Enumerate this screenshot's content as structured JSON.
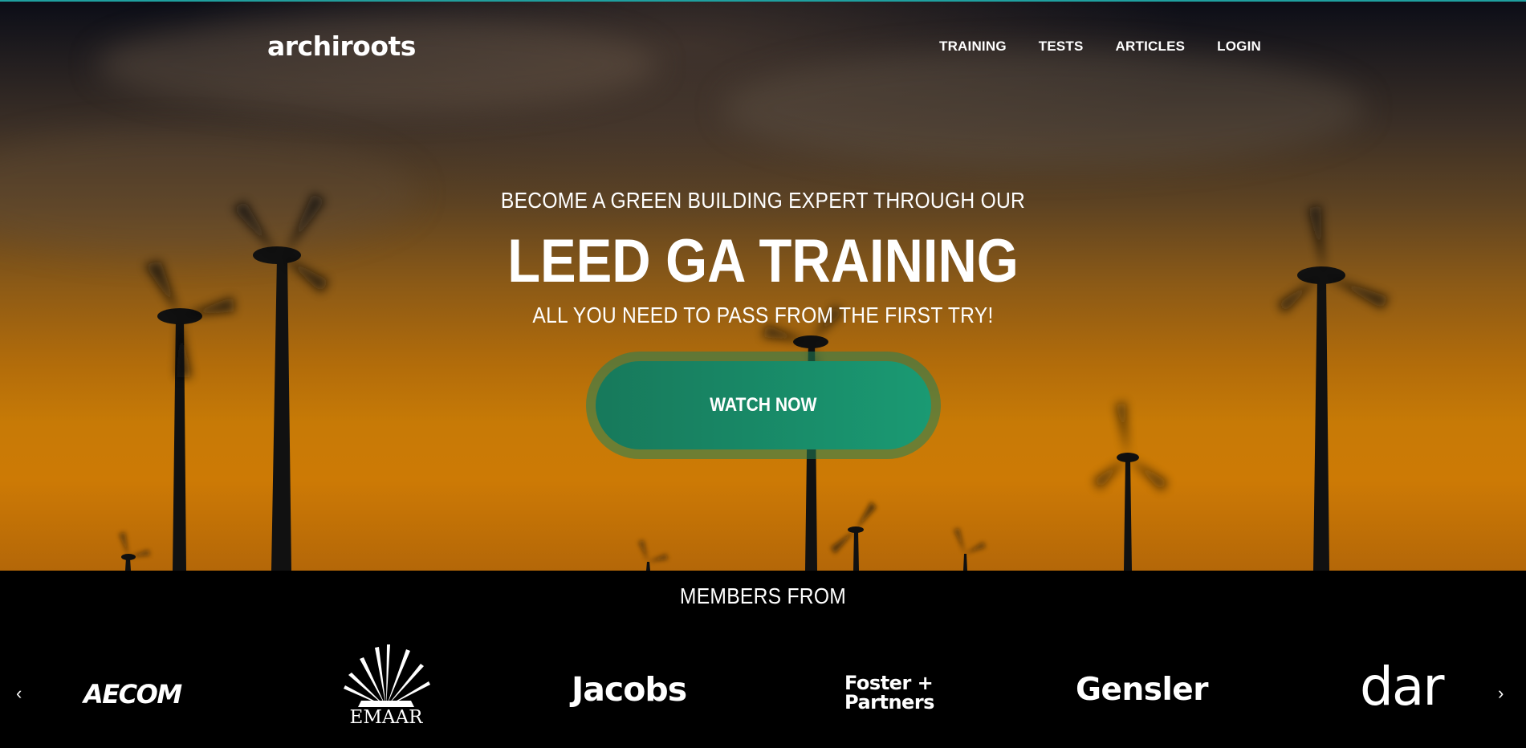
{
  "nav": {
    "logo": "archiroots",
    "items": [
      {
        "label": "TRAINING"
      },
      {
        "label": "TESTS"
      },
      {
        "label": "ARTICLES"
      },
      {
        "label": "LOGIN"
      }
    ]
  },
  "hero": {
    "pretitle": "BECOME A GREEN BUILDING EXPERT THROUGH OUR",
    "title": "LEED GA TRAINING",
    "subtitle": "ALL YOU NEED TO PASS FROM THE FIRST TRY!",
    "cta_label": "WATCH NOW",
    "background": "wind turbines at sunset"
  },
  "members": {
    "title": "MEMBERS FROM",
    "prev_icon": "chevron-left-icon",
    "next_icon": "chevron-right-icon",
    "prev_glyph": "‹",
    "next_glyph": "›",
    "logos": [
      {
        "name": "AECOM",
        "text": "AECOM"
      },
      {
        "name": "EMAAR",
        "text": "EMAAR"
      },
      {
        "name": "Jacobs",
        "text": "Jacobs"
      },
      {
        "name": "Foster + Partners",
        "line1": "Foster +",
        "line2": "Partners"
      },
      {
        "name": "Gensler",
        "text": "Gensler"
      },
      {
        "name": "dar",
        "text": "dar"
      }
    ]
  },
  "colors": {
    "cta": "#1a8a68",
    "accent_line": "#1fa0a0",
    "sky_top": "#0b0d17",
    "sky_bottom": "#cd7a05"
  }
}
